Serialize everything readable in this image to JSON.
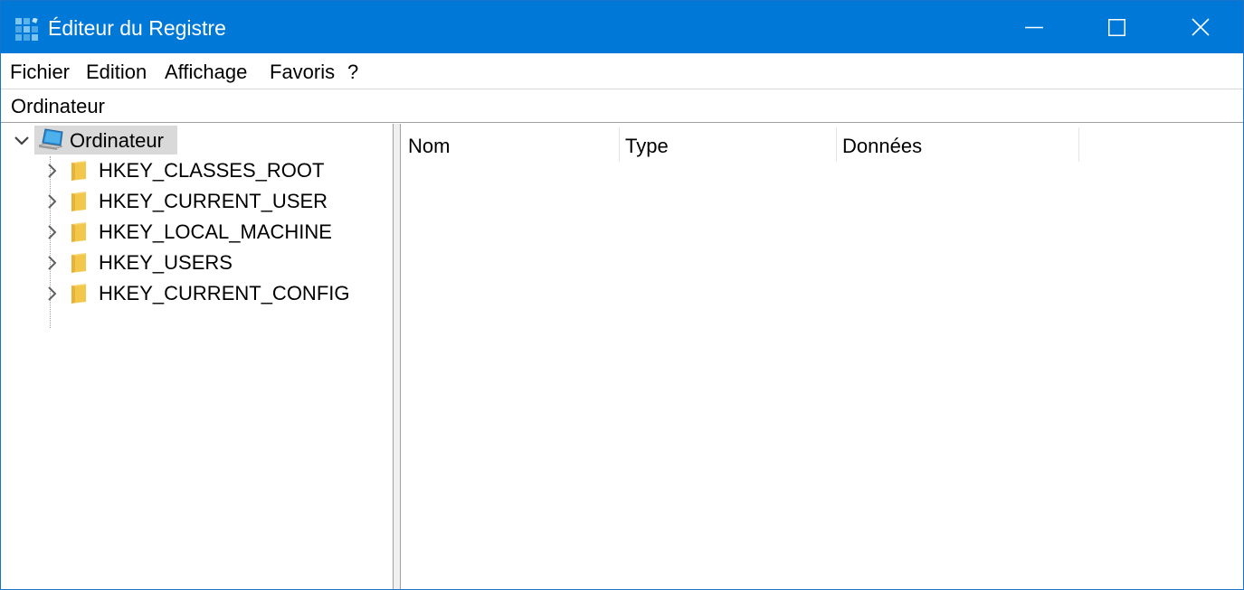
{
  "window": {
    "title": "Éditeur du Registre",
    "accent_color": "#0078d7",
    "controls": {
      "minimize_icon": "minimize-icon",
      "maximize_icon": "maximize-icon",
      "close_icon": "close-icon"
    }
  },
  "menu": {
    "items": [
      {
        "label": "Fichier"
      },
      {
        "label": "Edition"
      },
      {
        "label": "Affichage"
      },
      {
        "label": "Favoris"
      },
      {
        "label": "?"
      }
    ]
  },
  "address": {
    "path": "Ordinateur"
  },
  "tree": {
    "root": {
      "label": "Ordinateur",
      "icon": "computer-icon",
      "expanded": true,
      "selected": true
    },
    "children": [
      {
        "label": "HKEY_CLASSES_ROOT",
        "icon": "folder-icon"
      },
      {
        "label": "HKEY_CURRENT_USER",
        "icon": "folder-icon"
      },
      {
        "label": "HKEY_LOCAL_MACHINE",
        "icon": "folder-icon"
      },
      {
        "label": "HKEY_USERS",
        "icon": "folder-icon"
      },
      {
        "label": "HKEY_CURRENT_CONFIG",
        "icon": "folder-icon"
      }
    ]
  },
  "list": {
    "columns": [
      {
        "label": "Nom"
      },
      {
        "label": "Type"
      },
      {
        "label": "Données"
      }
    ],
    "rows": []
  }
}
